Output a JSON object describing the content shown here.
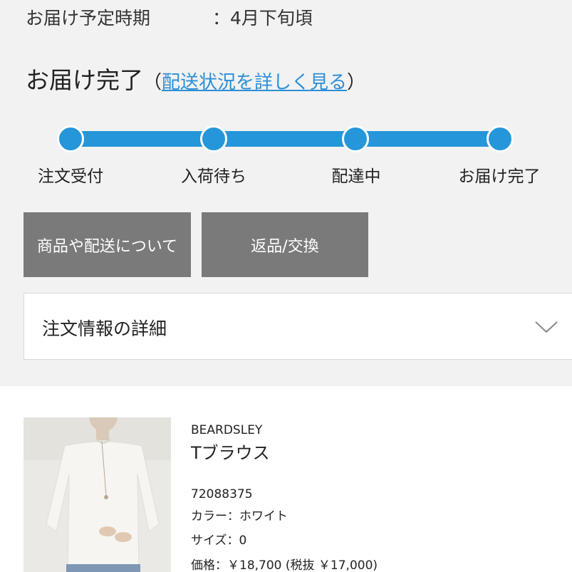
{
  "delivery": {
    "period_label": "お届け予定時期",
    "period_value": "：4月下旬頃"
  },
  "status": {
    "title": "お届け完了",
    "open_paren": "（",
    "link_text": "配送状況を詳しく見る",
    "close_paren": "）"
  },
  "progress": {
    "steps": [
      "注文受付",
      "入荷待ち",
      "配達中",
      "お届け完了"
    ],
    "completed_steps": 4,
    "total_steps": 4
  },
  "buttons": {
    "product_delivery": "商品や配送について",
    "return_exchange": "返品/交換"
  },
  "order_details": {
    "title": "注文情報の詳細"
  },
  "product": {
    "brand": "BEARDSLEY",
    "name": "Tブラウス",
    "item_number": "72088375",
    "color": "カラー：ホワイト",
    "size": "サイズ：0",
    "price": "価格：￥18,700 (税抜 ￥17,000)"
  },
  "colors": {
    "accent": "#2596d9",
    "button_bg": "#7a7a7a",
    "page_bg": "#f2f2f2",
    "link": "#2b8fd6"
  },
  "icons": {
    "accordion": "chevron-down-icon"
  }
}
